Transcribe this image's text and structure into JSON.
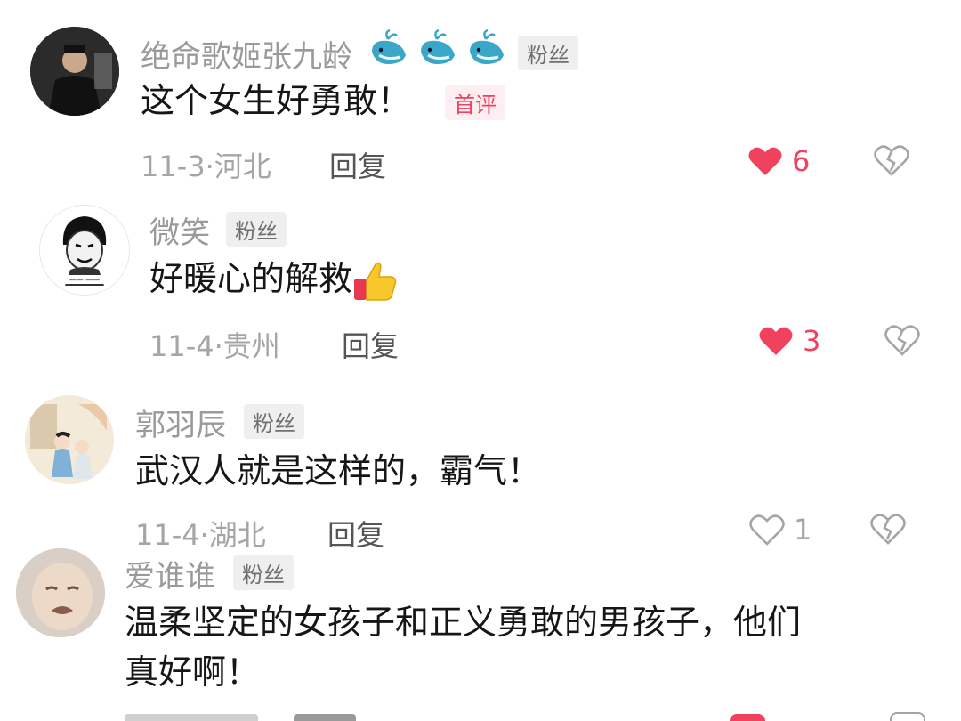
{
  "colors": {
    "liked_red": "#f0415f",
    "muted_gray": "#a5a5a5",
    "text_dark": "#161616"
  },
  "comments": [
    {
      "username": "绝命歌姬张九龄",
      "badge_icons": [
        "whale-icon",
        "whale-icon",
        "whale-icon"
      ],
      "fan_badge": "粉丝",
      "text": "这个女生好勇敢！",
      "first_badge": "首评",
      "date": "11-3",
      "location": "河北",
      "reply_label": "回复",
      "likes": "6",
      "liked": true
    },
    {
      "username": "微笑",
      "fan_badge": "粉丝",
      "text": "好暖心的解救",
      "emoji": "thumbs-up-emoji",
      "date": "11-4",
      "location": "贵州",
      "reply_label": "回复",
      "likes": "3",
      "liked": true
    },
    {
      "username": "郭羽辰",
      "fan_badge": "粉丝",
      "text": "武汉人就是这样的，霸气！",
      "date": "11-4",
      "location": "湖北",
      "reply_label": "回复",
      "likes": "1",
      "liked": false
    },
    {
      "username": "爱谁谁",
      "fan_badge": "粉丝",
      "text_line1": "温柔坚定的女孩子和正义勇敢的男孩子，他们",
      "text_line2": "真好啊！"
    }
  ]
}
